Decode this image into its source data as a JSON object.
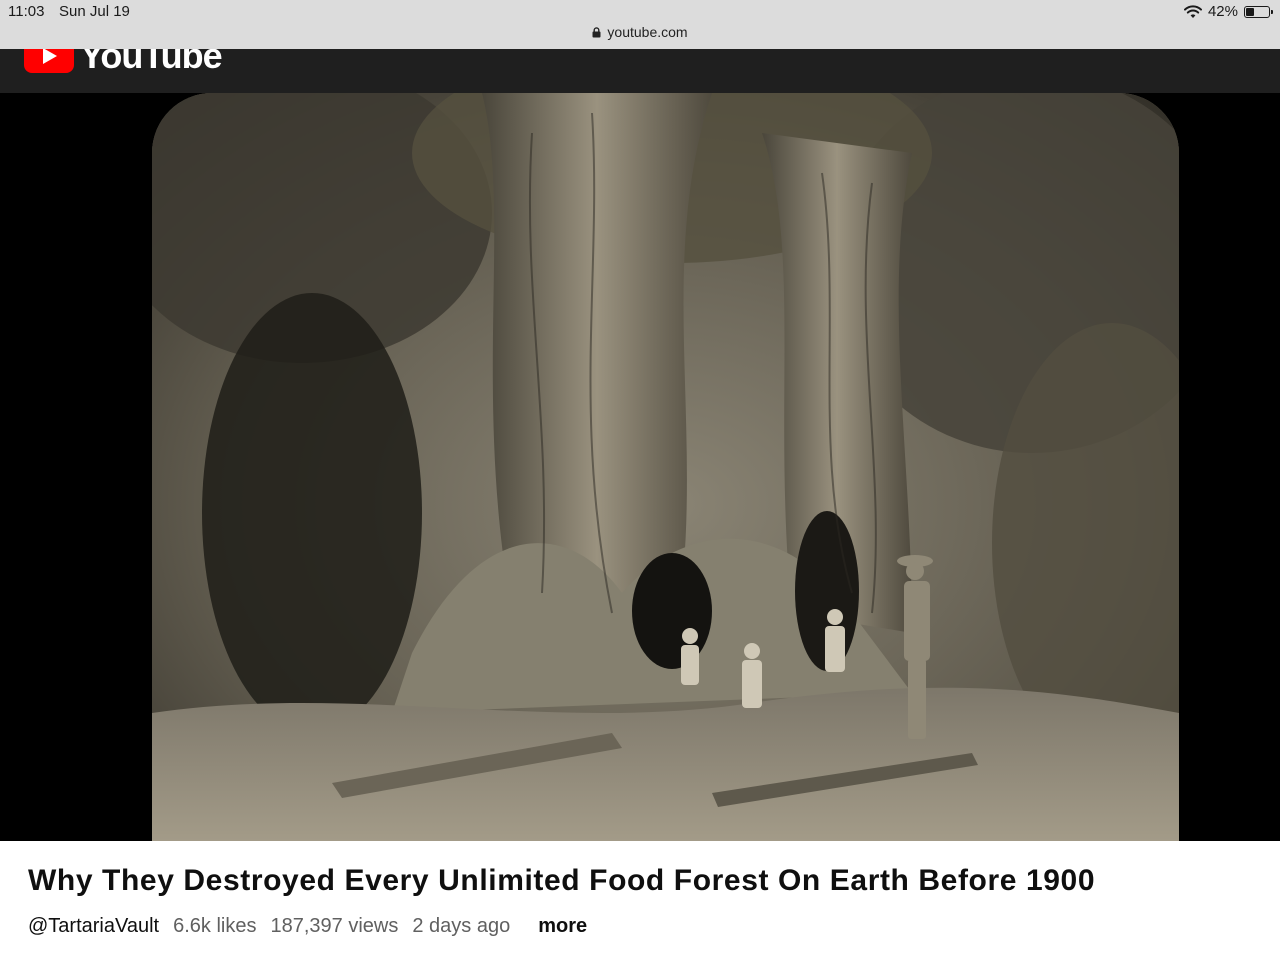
{
  "status_bar": {
    "time": "11:03",
    "date": "Sun Jul 19",
    "battery": "42%",
    "battery_level": 0.42,
    "url": "youtube.com"
  },
  "header": {
    "logo_text": "YouTube",
    "brand_color": "#ff0000"
  },
  "video": {
    "title": "Why They Destroyed Every Unlimited Food Forest On Earth Before 1900",
    "channel": "@TartariaVault",
    "likes": "6.6k likes",
    "views": "187,397 views",
    "posted": "2 days ago",
    "more_label": "more"
  },
  "colors": {
    "header_bg": "#1f1f1f",
    "player_bg": "#000000",
    "status_bg": "#dcdcdc",
    "text_primary": "#0f0f0f",
    "text_muted": "#606060"
  }
}
